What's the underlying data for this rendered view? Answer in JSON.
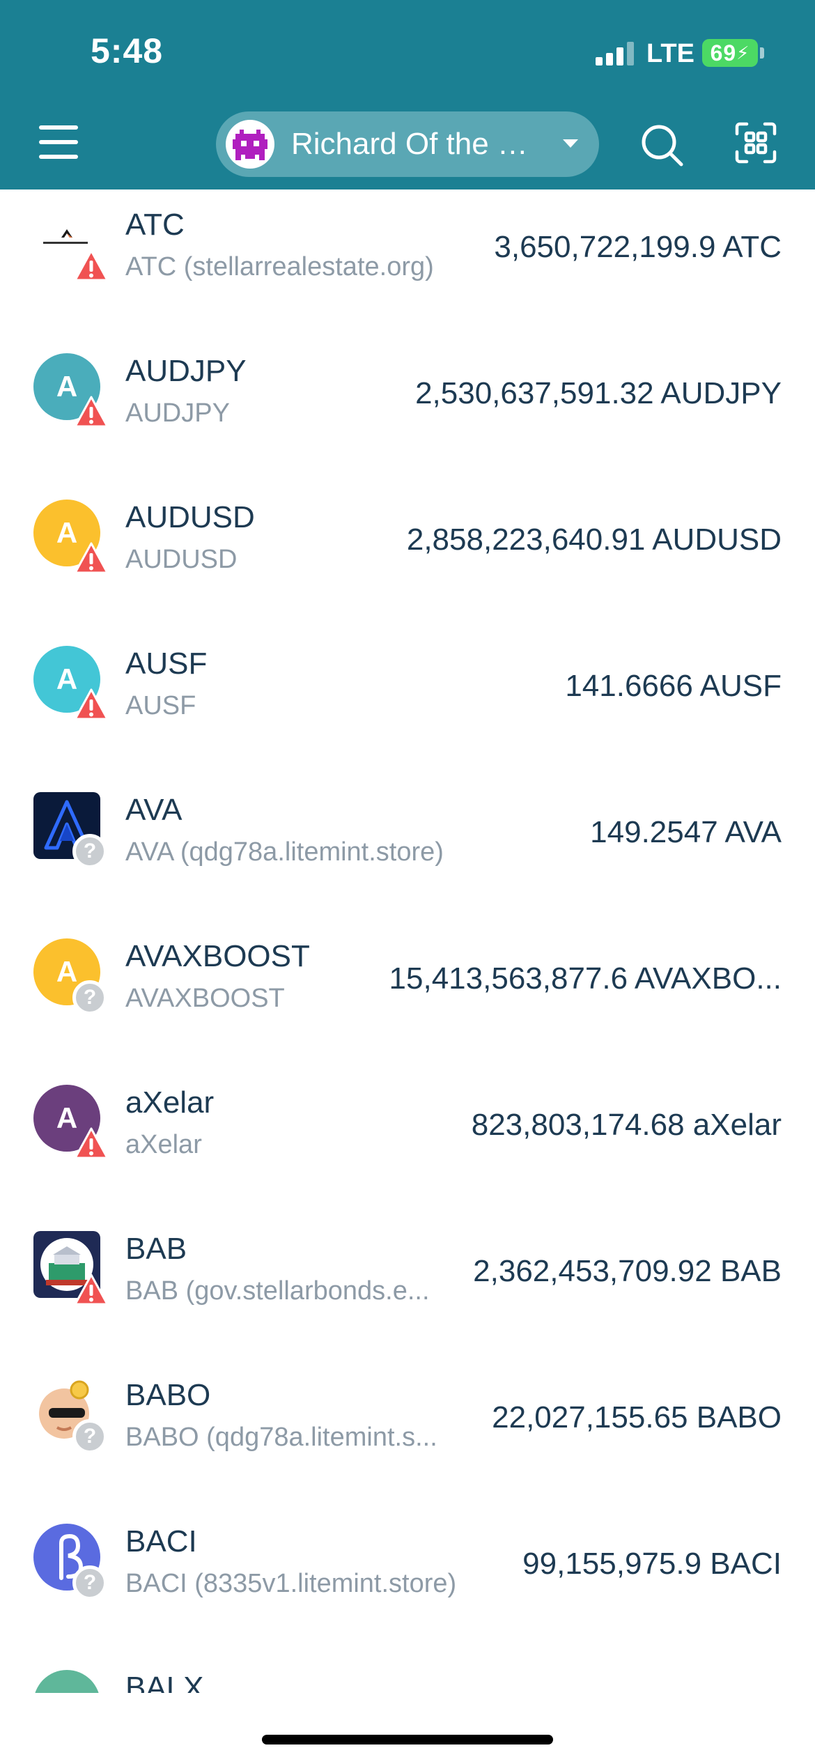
{
  "status_bar": {
    "time": "5:48",
    "network": "LTE",
    "battery": "69"
  },
  "header": {
    "account_name": "Richard Of the Rich...",
    "icons": {
      "menu": "hamburger-menu-icon",
      "search": "search-icon",
      "scan": "qr-scan-icon"
    }
  },
  "colors": {
    "header_bg": "#1b8093",
    "pill_bg": "#5aa7b4",
    "warning": "#f05252",
    "unknown_badge": "#c9cdd1",
    "text_primary": "#1d3a52",
    "text_secondary": "#8d9aa6"
  },
  "assets": [
    {
      "code": "ATC",
      "issuer": "ATC (stellarrealestate.org)",
      "balance": "3,650,722,199.9 ATC",
      "icon": "logo-image",
      "icon_color": "#ffffff",
      "badge": "warning"
    },
    {
      "code": "AUDJPY",
      "issuer": "AUDJPY",
      "balance": "2,530,637,591.32 AUDJPY",
      "icon": "A",
      "icon_color": "#4aadbb",
      "badge": "warning"
    },
    {
      "code": "AUDUSD",
      "issuer": "AUDUSD",
      "balance": "2,858,223,640.91 AUDUSD",
      "icon": "A",
      "icon_color": "#fbc02d",
      "badge": "warning"
    },
    {
      "code": "AUSF",
      "issuer": "AUSF",
      "balance": "141.6666 AUSF",
      "icon": "A",
      "icon_color": "#43c6d6",
      "badge": "warning"
    },
    {
      "code": "AVA",
      "issuer": "AVA (qdg78a.litemint.store)",
      "balance": "149.2547 AVA",
      "icon": "logo-image",
      "icon_color": "#0a1a3a",
      "badge": "unknown"
    },
    {
      "code": "AVAXBOOST",
      "issuer": "AVAXBOOST",
      "balance": "15,413,563,877.6 AVAXBO...",
      "icon": "A",
      "icon_color": "#fbc02d",
      "badge": "unknown"
    },
    {
      "code": "aXelar",
      "issuer": "aXelar",
      "balance": "823,803,174.68 aXelar",
      "icon": "A",
      "icon_color": "#6b3f7d",
      "badge": "warning"
    },
    {
      "code": "BAB",
      "issuer": "BAB (gov.stellarbonds.e...",
      "balance": "2,362,453,709.92 BAB",
      "icon": "logo-image",
      "icon_color": "#1f2a55",
      "badge": "warning"
    },
    {
      "code": "BABO",
      "issuer": "BABO (qdg78a.litemint.s...",
      "balance": "22,027,155.65 BABO",
      "icon": "logo-image",
      "icon_color": "#f2c4a0",
      "badge": "unknown"
    },
    {
      "code": "BACI",
      "issuer": "BACI (8335v1.litemint.store)",
      "balance": "99,155,975.9 BACI",
      "icon": "logo-image",
      "icon_color": "#5a6be0",
      "badge": "unknown"
    },
    {
      "code": "BALX",
      "issuer": "",
      "balance": "",
      "icon": "logo-image",
      "icon_color": "#5fb79a",
      "badge": "none"
    }
  ]
}
